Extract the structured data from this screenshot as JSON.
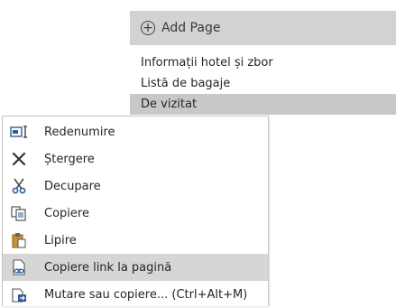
{
  "pages_panel": {
    "add_page_label": "Add Page",
    "pages": [
      {
        "title": "Informații hotel și zbor",
        "selected": false
      },
      {
        "title": "Listă de bagaje",
        "selected": false
      },
      {
        "title": "De vizitat",
        "selected": true
      }
    ]
  },
  "context_menu": {
    "items": [
      {
        "label": "Redenumire",
        "icon": "rename-icon"
      },
      {
        "label": "Ștergere",
        "icon": "delete-icon"
      },
      {
        "label": "Decupare",
        "icon": "cut-icon"
      },
      {
        "label": "Copiere",
        "icon": "copy-icon"
      },
      {
        "label": "Lipire",
        "icon": "paste-icon"
      },
      {
        "label": "Copiere link la pagină",
        "icon": "copy-link-icon",
        "hovered": true
      },
      {
        "label": "Mutare sau copiere...  (Ctrl+Alt+M)",
        "icon": "move-copy-icon"
      }
    ]
  }
}
